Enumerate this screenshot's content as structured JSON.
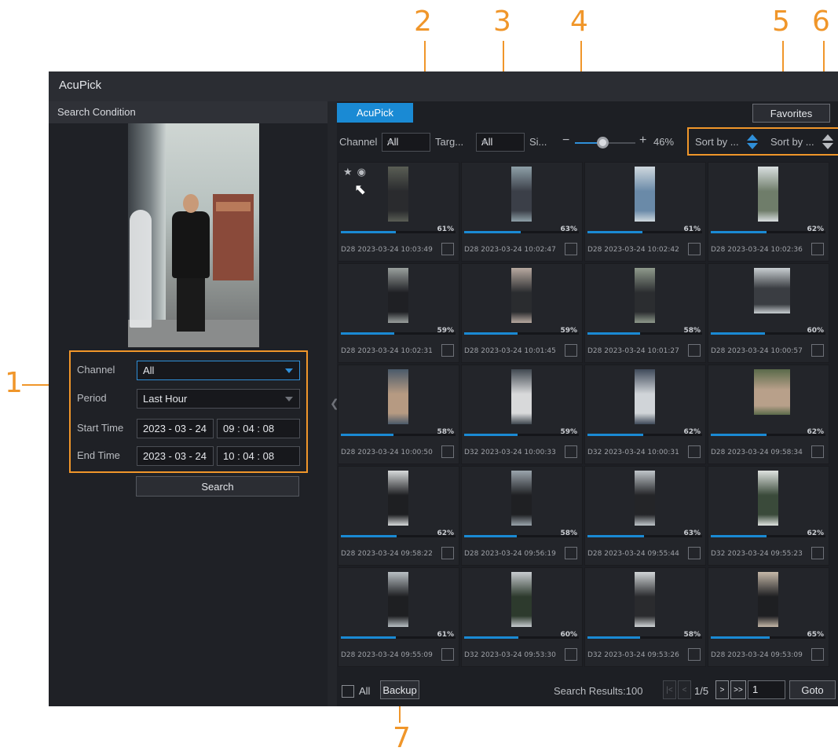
{
  "window": {
    "title": "AcuPick"
  },
  "callouts": [
    "1",
    "2",
    "3",
    "4",
    "5",
    "6",
    "7"
  ],
  "left": {
    "header": "Search Condition",
    "channel_label": "Channel",
    "channel_value": "All",
    "period_label": "Period",
    "period_value": "Last Hour",
    "start_label": "Start Time",
    "start_date": "2023 - 03 - 24",
    "start_time": "09 : 04 : 08",
    "end_label": "End Time",
    "end_date": "2023 - 03 - 24",
    "end_time": "10 : 04 : 08",
    "search_label": "Search"
  },
  "right": {
    "tab": "AcuPick",
    "favorites_label": "Favorites",
    "toolbar": {
      "channel_label": "Channel",
      "channel_value": "All",
      "target_label": "Targ...",
      "target_value": "All",
      "size_label": "Si...",
      "minus": "−",
      "plus": "+",
      "zoom": "46%",
      "sort1": "Sort by ...",
      "sort2": "Sort by ..."
    },
    "results": [
      {
        "pct": "61%",
        "fill": 0.61,
        "date": "D28 2023-03-24 10:03:49"
      },
      {
        "pct": "63%",
        "fill": 0.63,
        "date": "D28 2023-03-24 10:02:47"
      },
      {
        "pct": "61%",
        "fill": 0.61,
        "date": "D28 2023-03-24 10:02:42"
      },
      {
        "pct": "62%",
        "fill": 0.62,
        "date": "D28 2023-03-24 10:02:36"
      },
      {
        "pct": "59%",
        "fill": 0.59,
        "date": "D28 2023-03-24 10:02:31"
      },
      {
        "pct": "59%",
        "fill": 0.59,
        "date": "D28 2023-03-24 10:01:45"
      },
      {
        "pct": "58%",
        "fill": 0.58,
        "date": "D28 2023-03-24 10:01:27"
      },
      {
        "pct": "60%",
        "fill": 0.6,
        "date": "D28 2023-03-24 10:00:57"
      },
      {
        "pct": "58%",
        "fill": 0.58,
        "date": "D28 2023-03-24 10:00:50"
      },
      {
        "pct": "59%",
        "fill": 0.59,
        "date": "D32 2023-03-24 10:00:33"
      },
      {
        "pct": "62%",
        "fill": 0.62,
        "date": "D32 2023-03-24 10:00:31"
      },
      {
        "pct": "62%",
        "fill": 0.62,
        "date": "D28 2023-03-24 09:58:34"
      },
      {
        "pct": "62%",
        "fill": 0.62,
        "date": "D28 2023-03-24 09:58:22"
      },
      {
        "pct": "58%",
        "fill": 0.58,
        "date": "D28 2023-03-24 09:56:19"
      },
      {
        "pct": "63%",
        "fill": 0.63,
        "date": "D28 2023-03-24 09:55:44"
      },
      {
        "pct": "62%",
        "fill": 0.62,
        "date": "D32 2023-03-24 09:55:23"
      },
      {
        "pct": "61%",
        "fill": 0.61,
        "date": "D28 2023-03-24 09:55:09"
      },
      {
        "pct": "60%",
        "fill": 0.6,
        "date": "D32 2023-03-24 09:53:30"
      },
      {
        "pct": "58%",
        "fill": 0.58,
        "date": "D32 2023-03-24 09:53:26"
      },
      {
        "pct": "65%",
        "fill": 0.65,
        "date": "D28 2023-03-24 09:53:09"
      }
    ],
    "bottom": {
      "all_label": "All",
      "backup_label": "Backup",
      "results_text": "Search Results:100",
      "first": "|<",
      "prev": "<",
      "page_count": "1/5",
      "next": ">",
      "last": ">>",
      "page_input": "1",
      "goto_label": "Goto"
    }
  },
  "icons": {
    "favorite": "star-icon",
    "view": "eye-icon",
    "cursor": "pointer-cursor-icon",
    "collapse": "chevron-left-icon"
  },
  "colors": {
    "accent": "#1a8ad4",
    "callout": "#f0962a",
    "background": "#1d1f24"
  }
}
